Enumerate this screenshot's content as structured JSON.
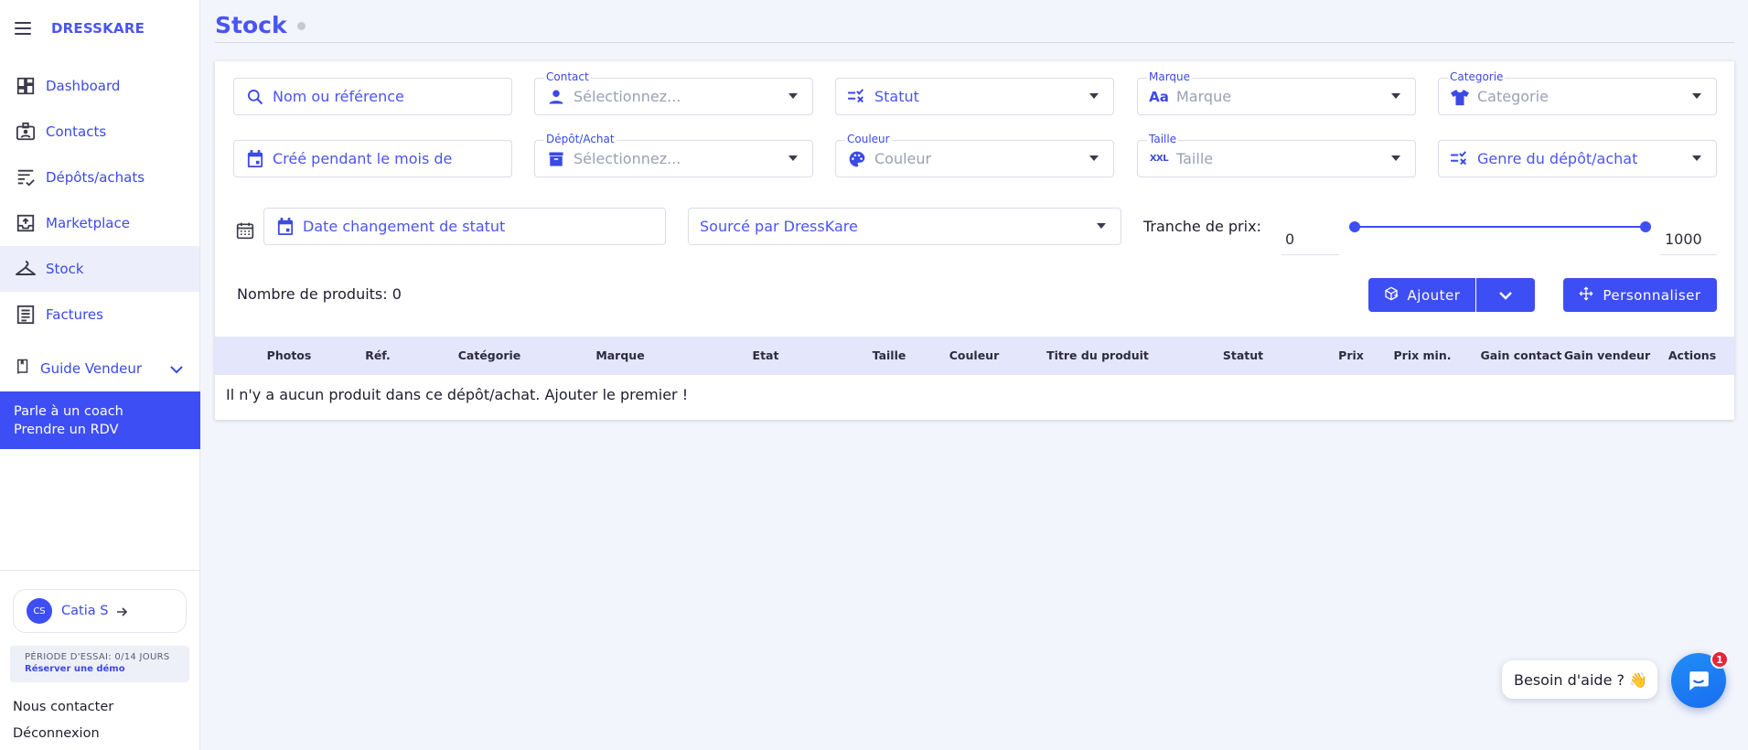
{
  "brand": "DRESSKARE",
  "nav": [
    {
      "label": "Dashboard"
    },
    {
      "label": "Contacts"
    },
    {
      "label": "Dépôts/achats"
    },
    {
      "label": "Marketplace"
    },
    {
      "label": "Stock"
    },
    {
      "label": "Factures"
    }
  ],
  "guide_label": "Guide Vendeur",
  "coach": {
    "line1": "Parle à un coach",
    "line2": "Prendre un RDV"
  },
  "user": {
    "initials": "CS",
    "name": "Catia S"
  },
  "trial": {
    "text": "PÉRIODE D'ESSAI: 0/14 JOURS",
    "link": "Réserver une démo"
  },
  "bottom_links": {
    "contact": "Nous contacter",
    "logout": "Déconnexion"
  },
  "page_title": "Stock",
  "filters": {
    "search_placeholder": "Nom ou référence",
    "contact": {
      "label": "Contact",
      "placeholder": "Sélectionnez..."
    },
    "statut": {
      "text": "Statut"
    },
    "marque": {
      "label": "Marque",
      "placeholder": "Marque"
    },
    "categorie": {
      "label": "Categorie",
      "placeholder": "Categorie"
    },
    "created_month": "Créé pendant le mois de",
    "depot": {
      "label": "Dépôt/Achat",
      "placeholder": "Sélectionnez..."
    },
    "couleur": {
      "label": "Couleur",
      "placeholder": "Couleur"
    },
    "taille": {
      "label": "Taille",
      "placeholder": "Taille"
    },
    "genre": {
      "text": "Genre du dépôt/achat"
    },
    "date_status": "Date changement de statut",
    "source": "Sourcé par DressKare",
    "price_label": "Tranche de prix:",
    "price_min": "0",
    "price_max": "1000"
  },
  "count_text": "Nombre de produits: 0",
  "buttons": {
    "add": "Ajouter",
    "customize": "Personnaliser"
  },
  "columns": [
    "Photos",
    "Réf.",
    "Catégorie",
    "Marque",
    "Etat",
    "Taille",
    "Couleur",
    "Titre du produit",
    "Statut",
    "Prix",
    "Prix min.",
    "Gain contact",
    "Gain vendeur",
    "Actions"
  ],
  "empty_text": "Il n'y a aucun produit dans ce dépôt/achat. Ajouter le premier !",
  "help_text": "Besoin d'aide ? 👋",
  "chat_badge": "1",
  "colors": {
    "primary": "#3d4ef5",
    "sidebar_active": "#eceefb",
    "table_header": "#e4e6fb",
    "badge": "#e8243a"
  }
}
